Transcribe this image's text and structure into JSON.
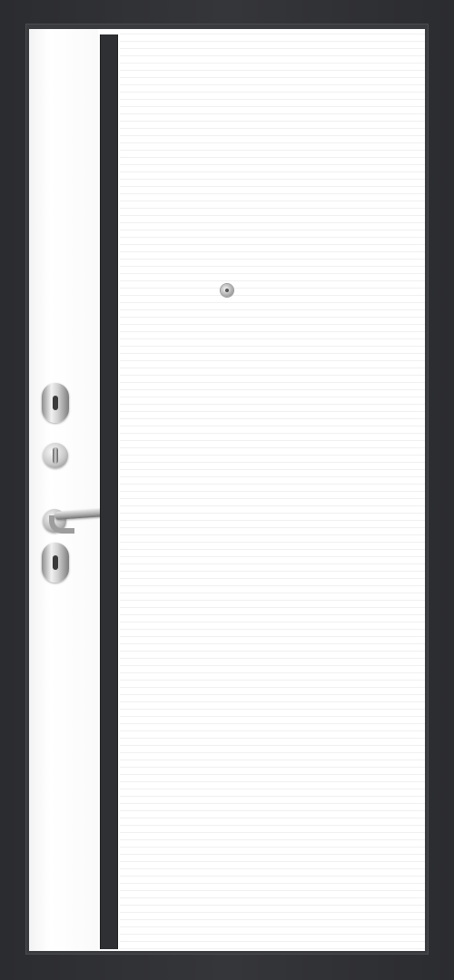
{
  "scene": {
    "subject": "door",
    "colors": {
      "frame": "#2b2c2f",
      "panel": "#ffffff",
      "insert": "#2f3033",
      "hardware": "#c9c9c9"
    },
    "icons": [
      "peephole-icon",
      "lock-icon",
      "thumb-turn-icon",
      "door-handle-icon"
    ]
  }
}
